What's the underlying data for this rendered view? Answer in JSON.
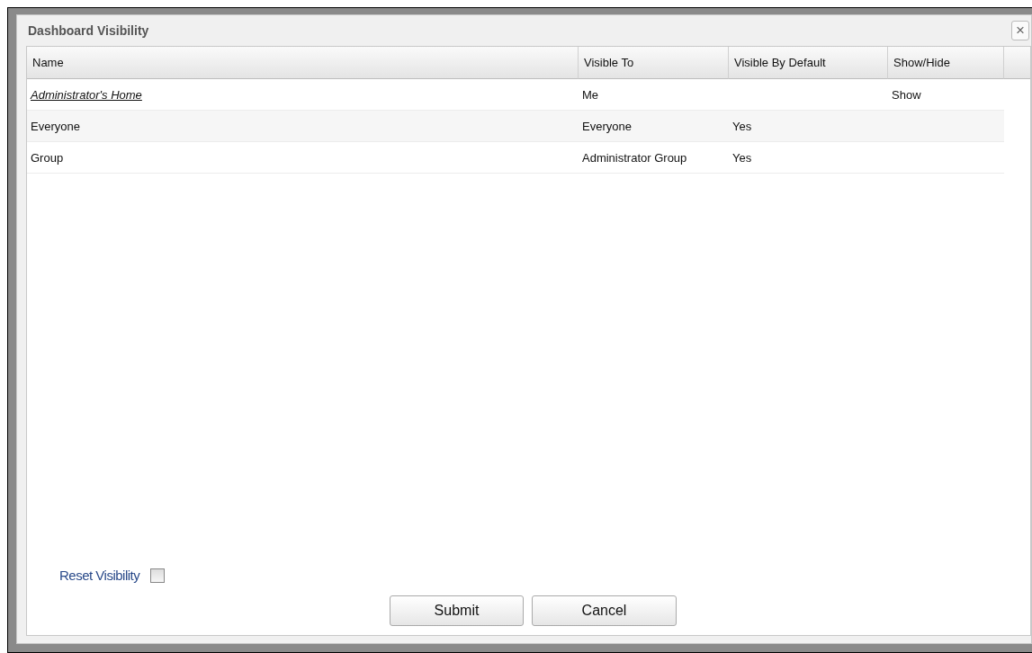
{
  "window": {
    "title": "Dashboard Visibility",
    "close": "×"
  },
  "table": {
    "columns": [
      "Name",
      "Visible To",
      "Visible By Default",
      "Show/Hide"
    ],
    "rows": [
      {
        "kind": "link",
        "cells": [
          "Administrator's Home",
          "Me",
          "",
          "Show"
        ]
      },
      {
        "kind": "text",
        "cells": [
          "Everyone",
          "Everyone",
          "Yes",
          ""
        ]
      },
      {
        "kind": "text",
        "cells": [
          "Group",
          "Administrator Group",
          "Yes",
          ""
        ]
      }
    ]
  },
  "reset": {
    "label": "Reset Visibility",
    "checked": false
  },
  "buttons": [
    "Submit",
    "Cancel"
  ]
}
